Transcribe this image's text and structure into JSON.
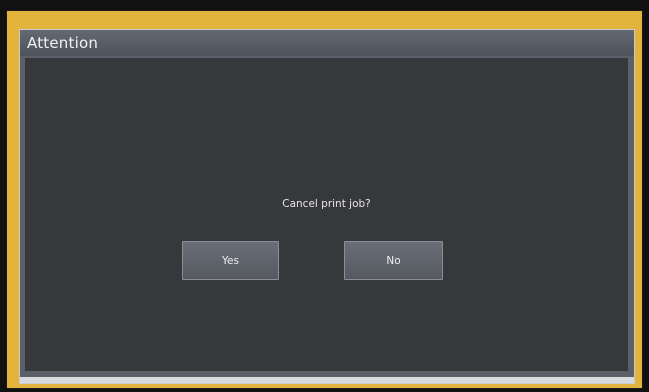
{
  "dialog": {
    "title": "Attention",
    "message": "Cancel print job?",
    "yes_label": "Yes",
    "no_label": "No"
  },
  "colors": {
    "frame_border": "#e3b43c",
    "title_bar": "#5a5f68",
    "body_background": "#37383c",
    "button_background": "#62666e"
  }
}
